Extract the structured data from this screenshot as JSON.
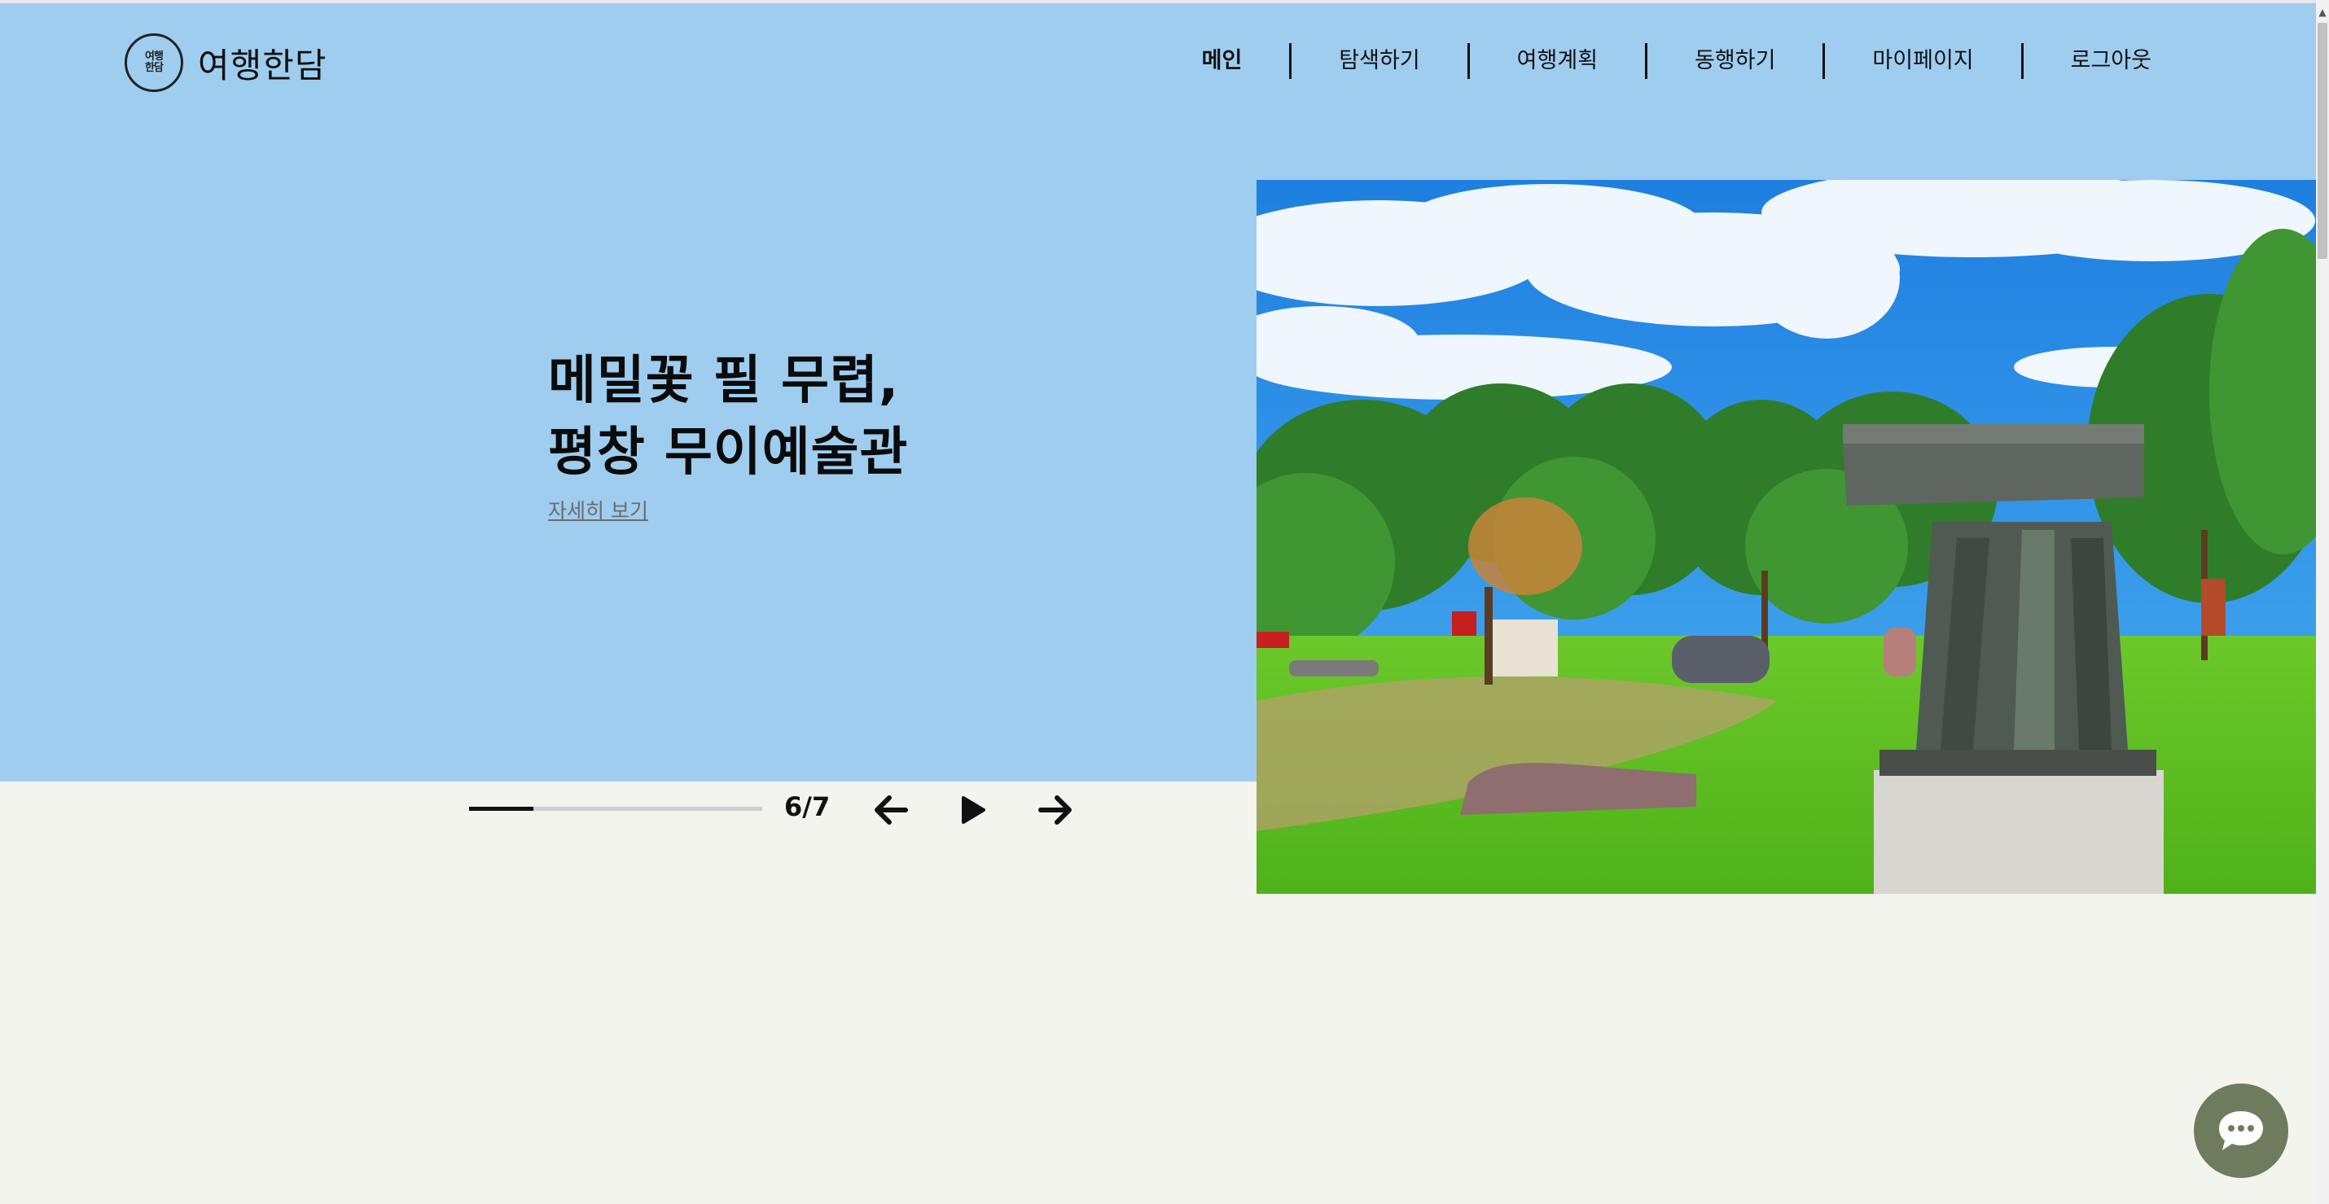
{
  "header": {
    "logo_mark": "여행\n한담",
    "logo_text": "여행한담",
    "nav": [
      "메인",
      "탐색하기",
      "여행계획",
      "동행하기",
      "마이페이지",
      "로그아웃"
    ],
    "active_nav": "메인"
  },
  "hero": {
    "title_line1": "메밀꽃 필 무렵,",
    "title_line2": "평창 무이예술관",
    "detail_link": "자세히 보기"
  },
  "slider": {
    "counter": "6/7",
    "progress": 0.22
  },
  "icons": {
    "prev": "arrow-left-icon",
    "play": "play-icon",
    "next": "arrow-right-icon",
    "chat": "chat-bubble-icon"
  },
  "colors": {
    "hero_background": "#9fcdef",
    "page_background": "#f4f4ee",
    "chat_button": "#6e7c5d"
  }
}
